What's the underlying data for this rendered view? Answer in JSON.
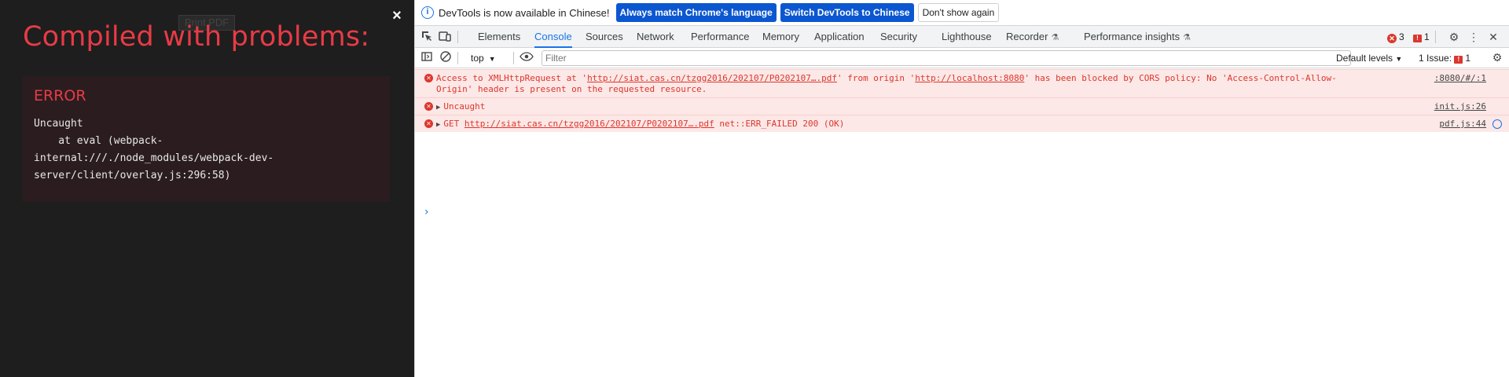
{
  "overlay": {
    "print_button": "Print PDF",
    "close": "×",
    "title": "Compiled with problems:",
    "error_label": "ERROR",
    "error_message": "Uncaught\n    at eval (webpack-\ninternal:///./node_modules/webpack-dev-\nserver/client/overlay.js:296:58)"
  },
  "devtools": {
    "infobar": {
      "text": "DevTools is now available in Chinese!",
      "btn_match": "Always match Chrome's language",
      "btn_switch": "Switch DevTools to Chinese",
      "btn_dismiss": "Don't show again"
    },
    "tabs": [
      "Elements",
      "Console",
      "Sources",
      "Network",
      "Performance",
      "Memory",
      "Application",
      "Security",
      "Lighthouse",
      "Recorder",
      "Performance insights"
    ],
    "active_tab": "Console",
    "error_count": "3",
    "issue_count": "1",
    "toolbar": {
      "context": "top",
      "filter_placeholder": "Filter",
      "levels": "Default levels",
      "issues": "1 Issue:",
      "issues_count": "1"
    },
    "messages": [
      {
        "pre": "Access to XMLHttpRequest at '",
        "url1": "http://siat.cas.cn/tzgg2016/202107/P0202107….pdf",
        "mid": "' from origin '",
        "url2": "http://localhost:8080",
        "post": "' has been blocked by CORS policy: No 'Access-Control-Allow-",
        "line2": "Origin' header is present on the requested resource.",
        "source": ":8080/#/:1"
      },
      {
        "text": "Uncaught",
        "source": "init.js:26"
      },
      {
        "pre": "GET ",
        "url": "http://siat.cas.cn/tzgg2016/202107/P0202107….pdf",
        "post": " net::ERR_FAILED 200 (OK)",
        "source": "pdf.js:44"
      }
    ],
    "prompt": "›"
  },
  "colors": {
    "error_red": "#dc362e",
    "overlay_red": "#e83b46",
    "accent_blue": "#1a73e8",
    "overlay_bg": "#1e1e1e"
  }
}
